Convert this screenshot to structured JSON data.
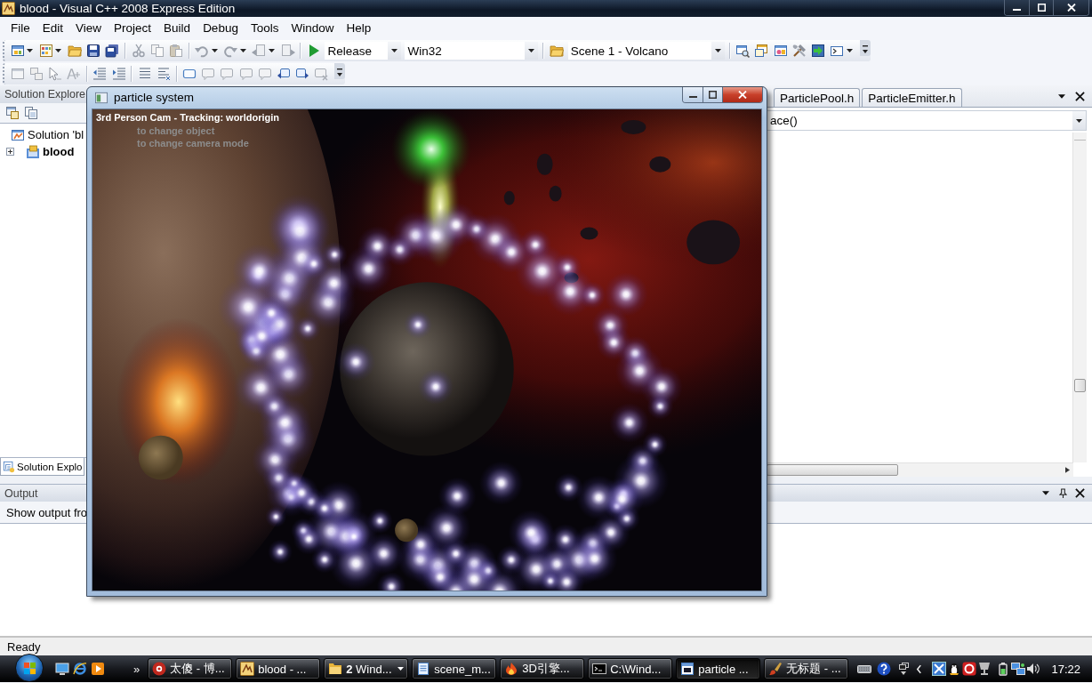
{
  "window": {
    "title": "blood - Visual C++ 2008 Express Edition"
  },
  "menu": [
    "File",
    "Edit",
    "View",
    "Project",
    "Build",
    "Debug",
    "Tools",
    "Window",
    "Help"
  ],
  "toolbar": {
    "configuration": "Release",
    "platform": "Win32",
    "find": "Scene 1 - Volcano"
  },
  "solution_explorer": {
    "title": "Solution Explore",
    "tree": [
      {
        "label": "Solution 'bl",
        "startup": false,
        "children": [
          {
            "label": "blood",
            "startup": true,
            "expanded": false
          }
        ]
      }
    ],
    "tabs": [
      {
        "label": "Solution Explo",
        "selected": true
      }
    ]
  },
  "editor": {
    "tabs": [
      {
        "label": "ParticlePool.h",
        "selected": false
      },
      {
        "label": "ParticleEmitter.h",
        "selected": false
      }
    ],
    "member_dropdown": "ace()"
  },
  "particle_window": {
    "title": "particle system",
    "overlay": [
      {
        "kind": "status",
        "text": "3rd Person Cam - Tracking: worldorigin"
      },
      {
        "kind": "hint",
        "text": "to change object"
      },
      {
        "kind": "hint",
        "text": "to change camera mode"
      }
    ]
  },
  "output": {
    "title": "Output",
    "source_label": "Show output fro"
  },
  "status_bar": {
    "text": "Ready"
  },
  "taskbar": {
    "overflow": "»",
    "buttons": [
      {
        "kind": "window",
        "label": "太傻 - 博...",
        "selected": false
      },
      {
        "kind": "window",
        "label": "blood - ...",
        "selected": false
      },
      {
        "kind": "group",
        "label": "**2** Wind...",
        "selected": false
      },
      {
        "kind": "window",
        "label": "scene_m...",
        "selected": false
      },
      {
        "kind": "window",
        "label": "3D引擎...",
        "selected": false
      },
      {
        "kind": "window",
        "label": "C:\\Wind...",
        "selected": false
      },
      {
        "kind": "window",
        "label": "particle ...",
        "selected": true
      },
      {
        "kind": "window",
        "label": "无标题 - ...",
        "selected": false
      }
    ],
    "clock": "17:22"
  }
}
